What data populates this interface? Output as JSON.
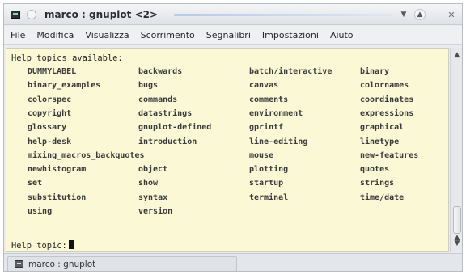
{
  "window": {
    "title": "marco : gnuplot <2>"
  },
  "menubar": {
    "items": [
      "File",
      "Modifica",
      "Visualizza",
      "Scorrimento",
      "Segnalibri",
      "Impostazioni",
      "Aiuto"
    ]
  },
  "terminal": {
    "header": "Help topics available:",
    "topics": [
      [
        "DUMMYLABEL",
        "backwards",
        "batch/interactive",
        "binary"
      ],
      [
        "binary_examples",
        "bugs",
        "canvas",
        "colornames"
      ],
      [
        "colorspec",
        "commands",
        "comments",
        "coordinates"
      ],
      [
        "copyright",
        "datastrings",
        "environment",
        "expressions"
      ],
      [
        "glossary",
        "gnuplot-defined",
        "gprintf",
        "graphical"
      ],
      [
        "help-desk",
        "introduction",
        "line-editing",
        "linetype"
      ],
      [
        "mixing_macros_backquotes",
        "",
        "mouse",
        "new-features"
      ],
      [
        "newhistogram",
        "object",
        "plotting",
        "quotes"
      ],
      [
        "set",
        "show",
        "startup",
        "strings"
      ],
      [
        "substitution",
        "syntax",
        "terminal",
        "time/date"
      ],
      [
        "using",
        "version",
        "",
        ""
      ]
    ],
    "prompt": "Help topic:"
  },
  "tabbar": {
    "tab_label": "marco : gnuplot"
  },
  "icons": {
    "app": "terminal-icon",
    "window_menu": "window-menu-icon",
    "minimize": "chevron-down-icon",
    "maximize": "chevron-up-icon",
    "close": "close-icon",
    "scroll_up": "scroll-up-arrow-icon",
    "scroll_down": "scroll-down-arrow-icon"
  },
  "colors": {
    "terminal_bg": "#fbf8d6",
    "terminal_fg": "#272727"
  }
}
